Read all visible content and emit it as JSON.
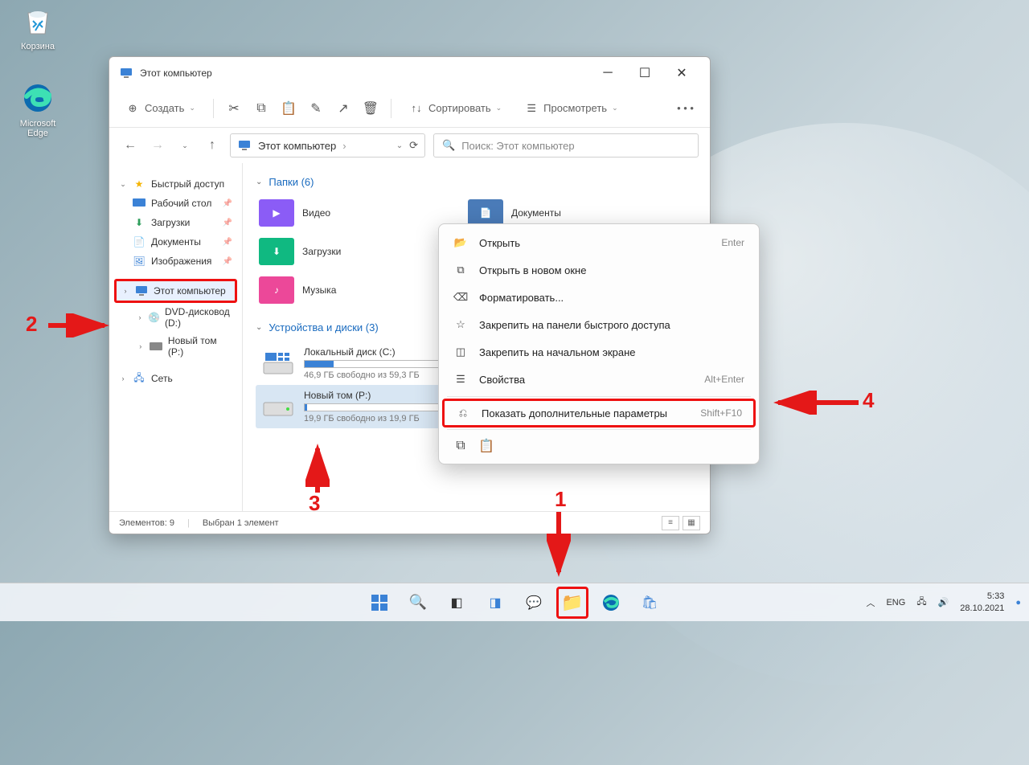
{
  "desktop": {
    "recycle_bin": "Корзина",
    "edge": "Microsoft Edge"
  },
  "window": {
    "title": "Этот компьютер",
    "toolbar": {
      "create": "Создать",
      "sort": "Сортировать",
      "view": "Просмотреть"
    },
    "breadcrumb": "Этот компьютер",
    "breadcrumb_sep": "›",
    "search_placeholder": "Поиск: Этот компьютер",
    "sidebar": {
      "quick_access": "Быстрый доступ",
      "desktop": "Рабочий стол",
      "downloads": "Загрузки",
      "documents": "Документы",
      "pictures": "Изображения",
      "this_pc": "Этот компьютер",
      "dvd": "DVD-дисковод (D:)",
      "new_volume": "Новый том (P:)",
      "network": "Сеть"
    },
    "content": {
      "folders_header": "Папки (6)",
      "videos": "Видео",
      "documents": "Документы",
      "downloads": "Загрузки",
      "music": "Музыка",
      "devices_header": "Устройства и диски (3)",
      "drive_c": {
        "name": "Локальный диск (C:)",
        "sub": "46,9 ГБ свободно из 59,3 ГБ",
        "fill": 21
      },
      "drive_p": {
        "name": "Новый том (P:)",
        "sub": "19,9 ГБ свободно из 19,9 ГБ",
        "fill": 2
      }
    },
    "status": {
      "elements": "Элементов: 9",
      "selected": "Выбран 1 элемент"
    }
  },
  "context_menu": {
    "open": {
      "label": "Открыть",
      "shortcut": "Enter"
    },
    "open_new": "Открыть в новом окне",
    "format": "Форматировать...",
    "pin_quick": "Закрепить на панели быстрого доступа",
    "pin_start": "Закрепить на начальном экране",
    "properties": {
      "label": "Свойства",
      "shortcut": "Alt+Enter"
    },
    "show_more": {
      "label": "Показать дополнительные параметры",
      "shortcut": "Shift+F10"
    }
  },
  "taskbar": {
    "lang": "ENG",
    "time": "5:33",
    "date": "28.10.2021"
  },
  "annotations": {
    "n1": "1",
    "n2": "2",
    "n3": "3",
    "n4": "4"
  }
}
